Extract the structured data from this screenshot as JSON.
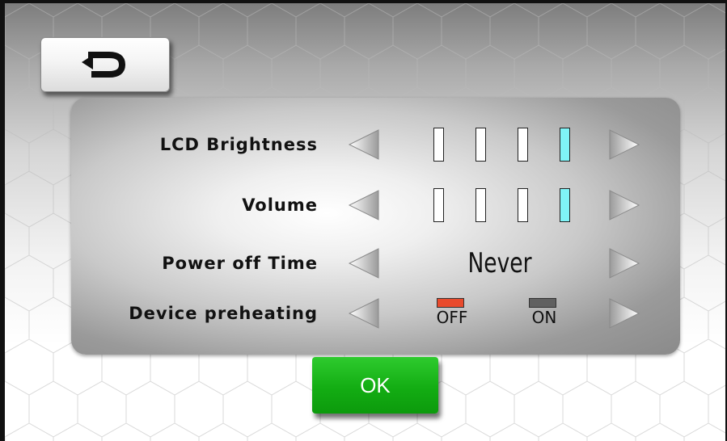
{
  "settings": {
    "rows": [
      {
        "label": "LCD Brightness",
        "level": 4,
        "max": 4
      },
      {
        "label": "Volume",
        "level": 4,
        "max": 4
      },
      {
        "label": "Power off Time",
        "value": "Never"
      },
      {
        "label": "Device preheating",
        "off_label": "OFF",
        "on_label": "ON",
        "selected": "OFF"
      }
    ]
  },
  "buttons": {
    "ok_label": "OK",
    "back_icon": "return-arrow-icon",
    "nav_icons": [
      "arrow-left-icon",
      "arrow-right-icon"
    ]
  },
  "colors": {
    "bar_active": "#7ff3f6",
    "toggle_selected": "#e84a2c",
    "toggle_unselected": "#606060",
    "ok_button": "#13ad13"
  }
}
